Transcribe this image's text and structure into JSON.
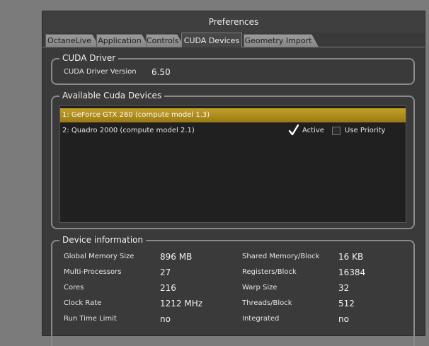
{
  "window": {
    "title": "Preferences"
  },
  "tabs": [
    {
      "label": "OctaneLive"
    },
    {
      "label": "Application"
    },
    {
      "label": "Controls"
    },
    {
      "label": "CUDA Devices"
    },
    {
      "label": "Geometry Import"
    }
  ],
  "cuda_driver": {
    "title": "CUDA Driver",
    "version_label": "CUDA Driver Version",
    "version_value": "6.50"
  },
  "available_devices": {
    "title": "Available Cuda Devices",
    "devices": [
      {
        "name": "1: GeForce GTX 260 (compute model 1.3)",
        "selected": true
      },
      {
        "name": "2: Quadro 2000 (compute model 2.1)",
        "active_label": "Active",
        "active": true,
        "priority_label": "Use Priority",
        "priority": false
      }
    ]
  },
  "device_info": {
    "title": "Device information",
    "left": [
      {
        "label": "Global Memory Size",
        "value": "896 MB"
      },
      {
        "label": "Multi-Processors",
        "value": "27"
      },
      {
        "label": "Cores",
        "value": "216"
      },
      {
        "label": "Clock Rate",
        "value": "1212 MHz"
      },
      {
        "label": "Run Time Limit",
        "value": "no"
      }
    ],
    "right": [
      {
        "label": "Shared Memory/Block",
        "value": "16 KB"
      },
      {
        "label": "Registers/Block",
        "value": "16384"
      },
      {
        "label": "Warp Size",
        "value": "32"
      },
      {
        "label": "Threads/Block",
        "value": "512"
      },
      {
        "label": "Integrated",
        "value": "no"
      }
    ]
  },
  "colors": {
    "selection": "#b8961f",
    "window_bg": "#3a3a3a",
    "desktop_bg": "#7b7b7b"
  }
}
